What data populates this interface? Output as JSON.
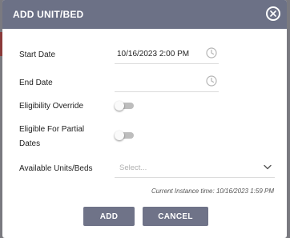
{
  "dialog": {
    "title": "ADD UNIT/BED",
    "close_icon": "close-circle-icon"
  },
  "form": {
    "start_date": {
      "label": "Start Date",
      "value": "10/16/2023 2:00 PM",
      "icon": "clock-icon"
    },
    "end_date": {
      "label": "End Date",
      "value": "",
      "icon": "clock-icon"
    },
    "eligibility_override": {
      "label": "Eligibility Override",
      "checked": false
    },
    "eligible_partial_dates": {
      "label_line1": "Eligible For Partial",
      "label_line2": "Dates",
      "checked": false
    },
    "available_units": {
      "label": "Available Units/Beds",
      "placeholder": "Select...",
      "icon": "chevron-down-icon"
    }
  },
  "instance_time": "Current Instance time: 10/16/2023 1:59 PM",
  "buttons": {
    "add": "ADD",
    "cancel": "CANCEL"
  },
  "colors": {
    "header": "#6c7186",
    "button": "#6f7388",
    "backdrop": "#7a7a80"
  }
}
